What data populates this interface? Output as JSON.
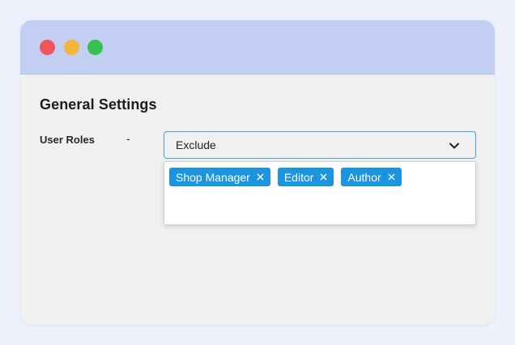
{
  "window": {
    "controls": [
      "close",
      "minimize",
      "maximize"
    ],
    "colors": {
      "close": "#f2545b",
      "minimize": "#f5b43a",
      "maximize": "#35c24f",
      "titlebar": "#c2cef2"
    }
  },
  "page": {
    "title": "General Settings"
  },
  "user_roles": {
    "label": "User Roles",
    "separator": "-",
    "select": {
      "value": "Exclude",
      "icon": "chevron-down-icon"
    },
    "selected_tags": [
      {
        "label": "Shop Manager",
        "remove_icon": "close-icon"
      },
      {
        "label": "Editor",
        "remove_icon": "close-icon"
      },
      {
        "label": "Author",
        "remove_icon": "close-icon"
      }
    ],
    "tag_color": "#1b95df",
    "accent_color": "#4aa0d8"
  }
}
